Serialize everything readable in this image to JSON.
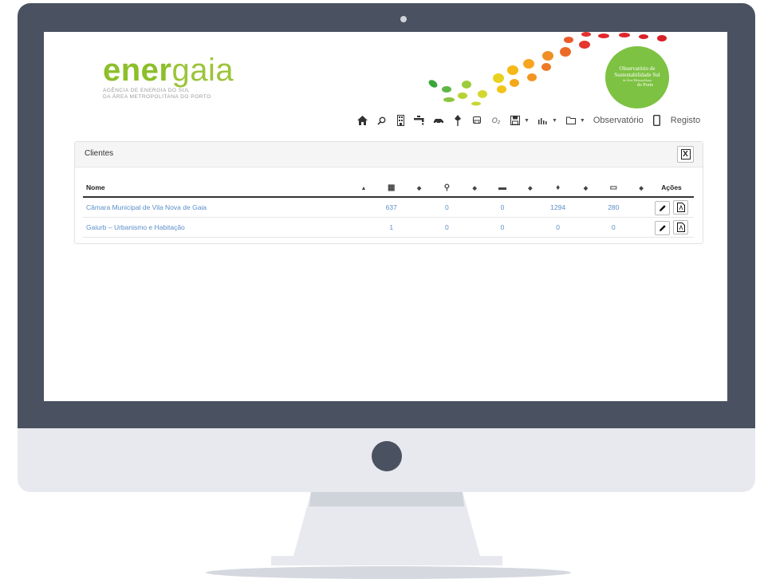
{
  "brand": {
    "logo_main": "ener",
    "logo_thin": "gaia",
    "logo_sub_line1": "AGÊNCIA DE ENERGIA DO SUL",
    "logo_sub_line2": "DA ÁREA METROPOLITANA DO PORTO",
    "brand_color": "#8cbf2a"
  },
  "badge": {
    "line1": "Observatório de",
    "line2": "Sustentabilidade Sul",
    "line3": "da Área Metropolitana",
    "line4": "do Porto",
    "color": "#7dc242"
  },
  "navbar": {
    "items": [
      {
        "icon": "home-icon",
        "glyph": "⌂"
      },
      {
        "icon": "search-icon",
        "glyph": "⚲"
      },
      {
        "icon": "building-icon",
        "glyph": "▤"
      },
      {
        "icon": "faucet-icon",
        "glyph": "⚲"
      },
      {
        "icon": "car-icon",
        "glyph": "▬"
      },
      {
        "icon": "lamp-icon",
        "glyph": "♦"
      },
      {
        "icon": "bus-icon",
        "glyph": "▭"
      },
      {
        "icon": "leaf-icon",
        "glyph": "ℓ"
      }
    ],
    "observatorio_label": "Observatório",
    "registo_label": "Registo"
  },
  "panel": {
    "title": "Clientes",
    "export_label": "X"
  },
  "table": {
    "columns": {
      "nome": "Nome",
      "acoes": "Ações"
    },
    "rows": [
      {
        "nome": "Câmara Municipal de Vila Nova de Gaia",
        "edificios": "637",
        "agua": "0",
        "frota": "0",
        "iluminacao": "1294",
        "transportes": "280"
      },
      {
        "nome": "Gaiurb – Urbanismo e Habitação",
        "edificios": "1",
        "agua": "0",
        "frota": "0",
        "iluminacao": "0",
        "transportes": "0"
      }
    ],
    "link_color": "#5b8fc9"
  }
}
